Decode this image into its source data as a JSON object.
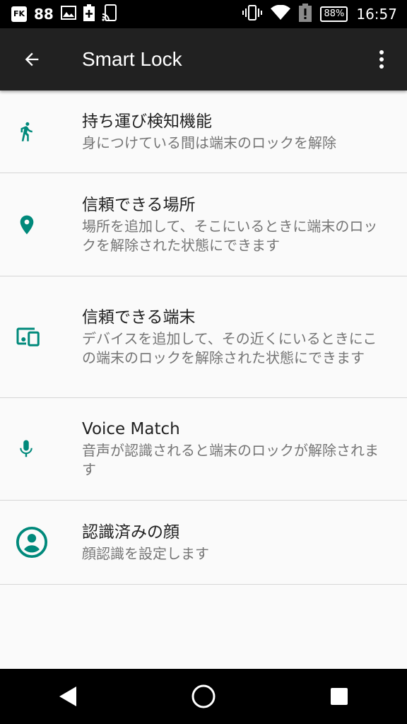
{
  "status_bar": {
    "notification_app": "FK",
    "notification_count": "88",
    "battery_percent": "88%",
    "time": "16:57",
    "icons": [
      "fk-notification-icon",
      "image-icon",
      "battery-saver-icon",
      "cast-icon",
      "vibrate-icon",
      "wifi-icon",
      "alert-icon",
      "battery-icon"
    ]
  },
  "app_bar": {
    "title": "Smart Lock",
    "back_icon": "arrow-back-icon",
    "menu_icon": "more-vert-icon"
  },
  "accent_color": "#00897b",
  "items": [
    {
      "icon": "walk-icon",
      "title": "持ち運び検知機能",
      "subtitle": "身につけている間は端末のロックを解除"
    },
    {
      "icon": "location-pin-icon",
      "title": "信頼できる場所",
      "subtitle": "場所を追加して、そこにいるときに端末のロックを解除された状態にできます"
    },
    {
      "icon": "devices-icon",
      "title": "信頼できる端末",
      "subtitle": "デバイスを追加して、その近くにいるときにこの端末のロックを解除された状態にできます"
    },
    {
      "icon": "mic-icon",
      "title": "Voice Match",
      "subtitle": "音声が認識されると端末のロックが解除されます"
    },
    {
      "icon": "face-icon",
      "title": "認識済みの顔",
      "subtitle": "顔認識を設定します"
    }
  ],
  "nav_bar": {
    "back": "nav-back-icon",
    "home": "nav-home-icon",
    "recents": "nav-recents-icon"
  }
}
